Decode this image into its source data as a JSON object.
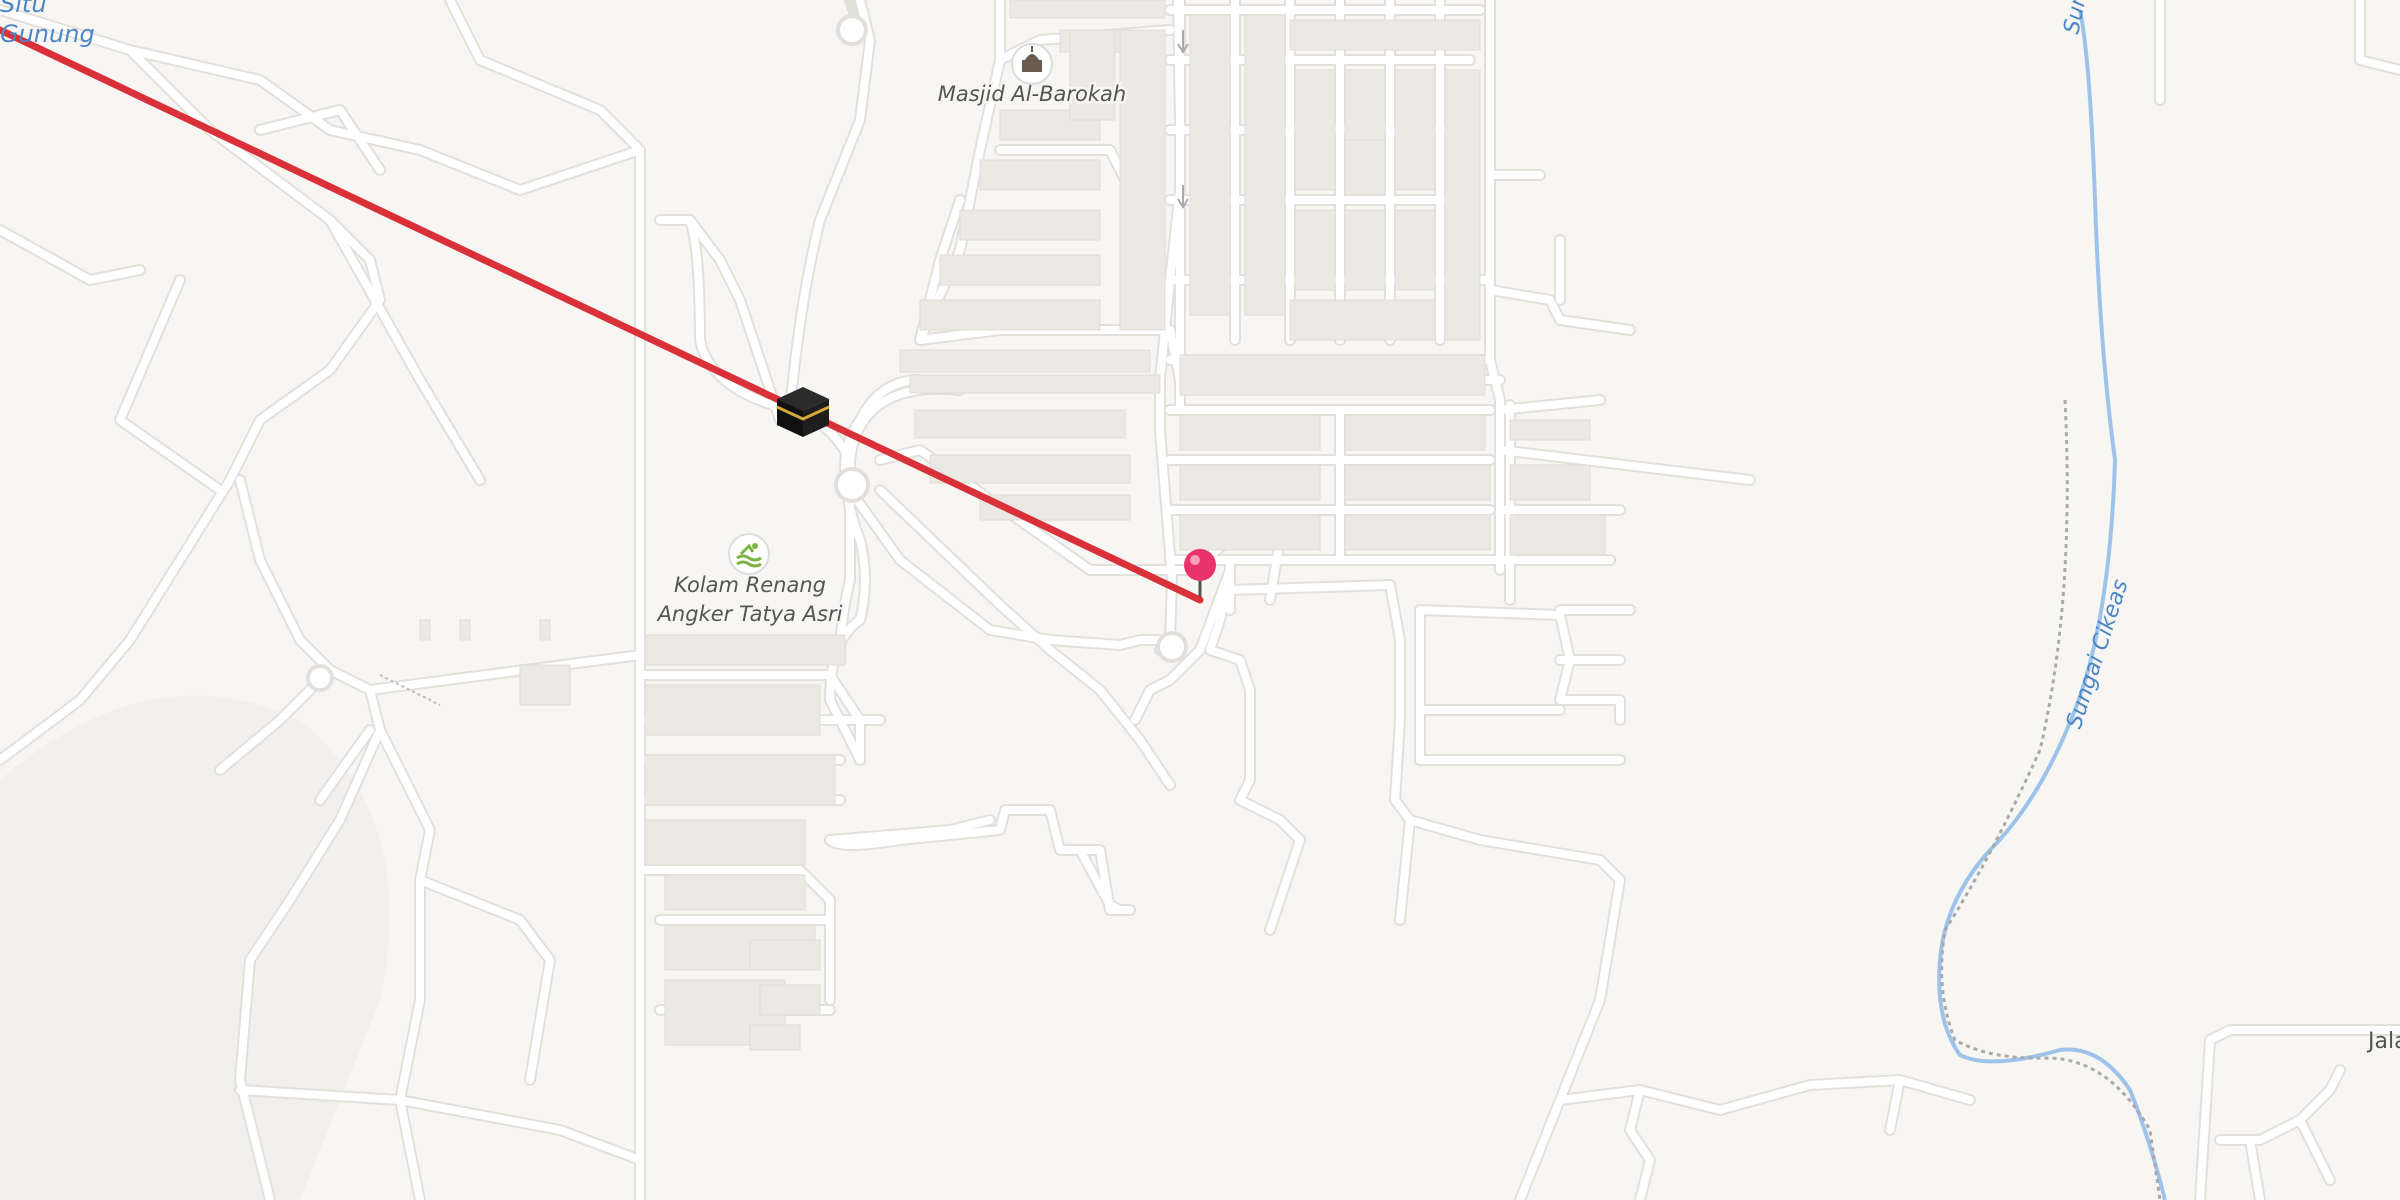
{
  "map": {
    "labels": {
      "masjid": "Masjid Al-Barokah",
      "pool_line1": "Kolam Renang",
      "pool_line2": "Angker Tatya Asri",
      "river": "Sungai Cikeas",
      "situ_line1": "Situ",
      "situ_line2": "Gunung",
      "jalan_partial": "Jala"
    },
    "colors": {
      "background": "#f8f6f3",
      "road": "#ffffff",
      "road_casing": "#e3e0dc",
      "building": "#ece8e3",
      "river": "#9ec3ea",
      "route_line": "#d9303a",
      "pin": "#e8336b",
      "pool_icon": "#7cb342"
    },
    "icons": {
      "mosque": "mosque-icon",
      "pool": "swimming-pool-icon",
      "kaaba": "kaaba-icon",
      "pin": "location-pin-icon"
    }
  }
}
